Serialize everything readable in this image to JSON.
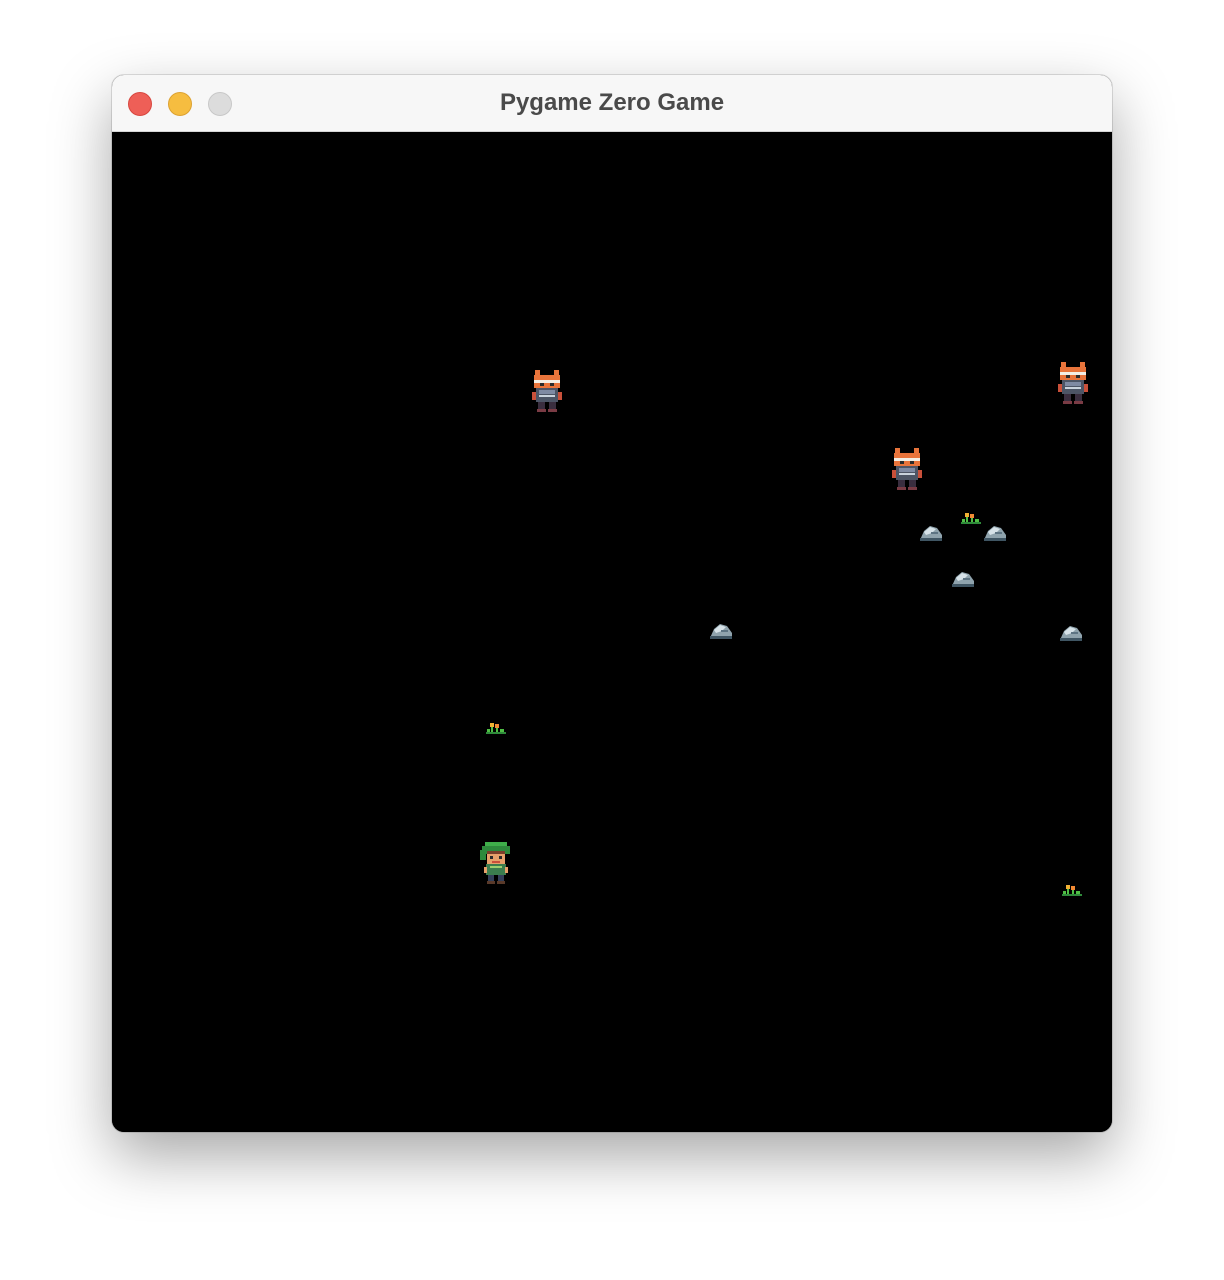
{
  "window": {
    "title": "Pygame Zero Game"
  },
  "colors": {
    "background": "#000000",
    "titlebar": "#f7f7f7",
    "close": "#ee5f57",
    "minimize": "#f6bd40",
    "maximize": "#dcdcdc"
  },
  "sprites": {
    "player": "green-helmet-hero-sprite",
    "enemies": [
      "fox-knight-sprite",
      "fox-knight-sprite",
      "fox-knight-sprite"
    ],
    "rocks": [
      "rock-sprite",
      "rock-sprite",
      "rock-sprite",
      "rock-sprite",
      "rock-sprite"
    ],
    "flowers": [
      "flower-sprite",
      "flower-sprite",
      "flower-sprite"
    ]
  }
}
